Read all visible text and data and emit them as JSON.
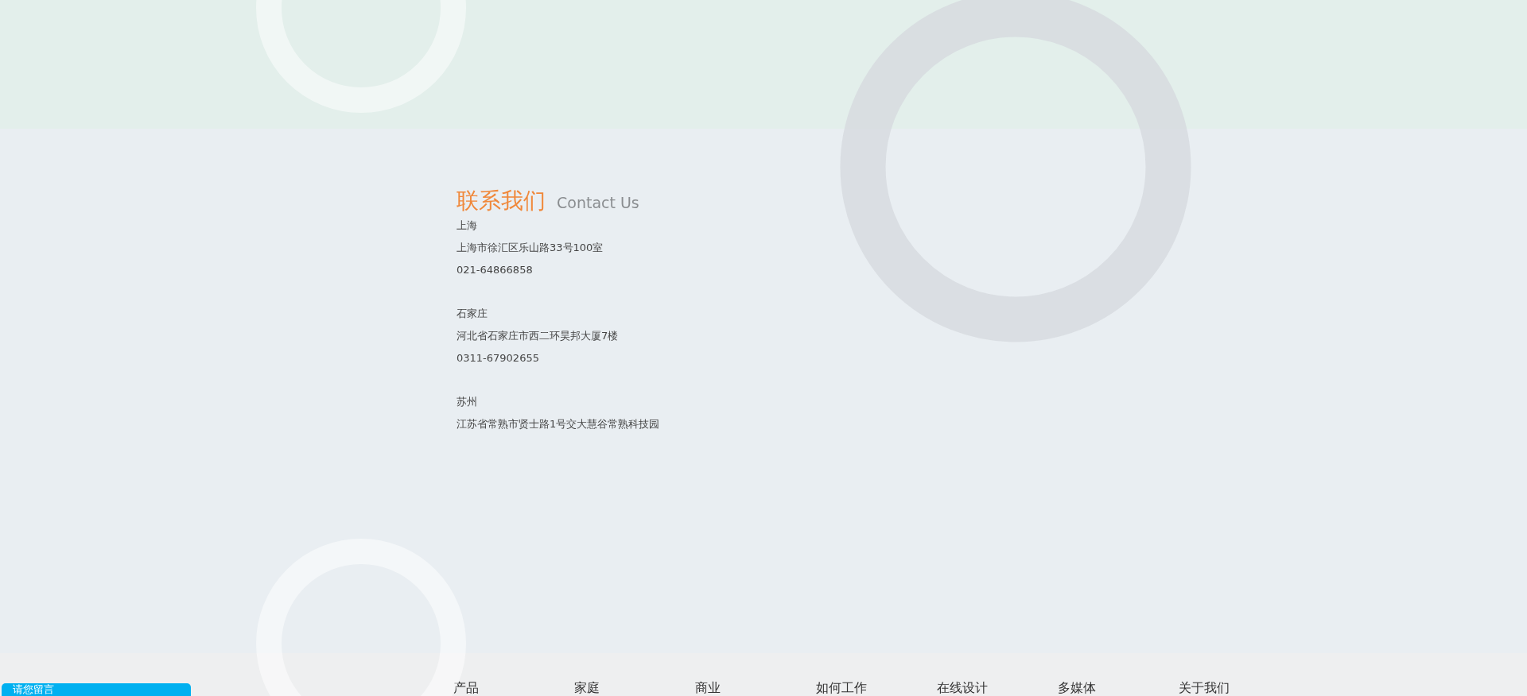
{
  "contact": {
    "title": "联系我们",
    "subtitle": "Contact Us",
    "offices": [
      {
        "city": "上海",
        "address": "上海市徐汇区乐山路33号100室",
        "phone": "021-64866858"
      },
      {
        "city": "石家庄",
        "address": "河北省石家庄市西二环昊邦大厦7楼",
        "phone": "0311-67902655"
      },
      {
        "city": "苏州",
        "address": "江苏省常熟市贤士路1号交大慧谷常熟科技园"
      }
    ]
  },
  "footer_nav": [
    "产品",
    "家庭",
    "商业",
    "如何工作",
    "在线设计",
    "多媒体",
    "关于我们"
  ],
  "message_button": "请您留言"
}
